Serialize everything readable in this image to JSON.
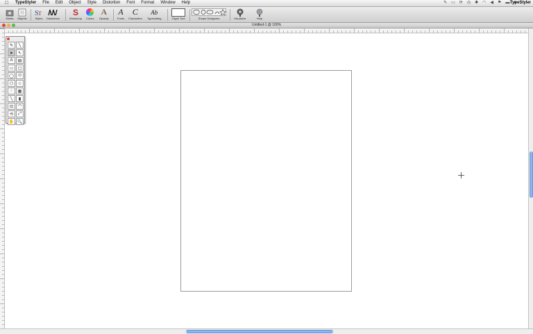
{
  "menubar": {
    "app": "TypeStyler",
    "menus": [
      "File",
      "Edit",
      "Object",
      "Style",
      "Distortion",
      "Font",
      "Format",
      "Window",
      "Help"
    ],
    "right_app": "TypeStyler"
  },
  "toolbar": {
    "items": [
      {
        "label": "Media",
        "icon": "media-icon"
      },
      {
        "label": "Objects",
        "icon": "objects-icon"
      },
      {
        "label": "Styles",
        "icon": "styles-icon"
      },
      {
        "label": "Distortions",
        "icon": "distortions-icon"
      },
      {
        "label": "Workshop",
        "icon": "workshop-icon",
        "glyph": "S"
      },
      {
        "label": "Colors",
        "icon": "colors-icon"
      },
      {
        "label": "Opacity",
        "icon": "opacity-icon",
        "glyph": "A"
      },
      {
        "label": "Fonts",
        "icon": "fonts-icon",
        "glyph": "A"
      },
      {
        "label": "Characters",
        "icon": "characters-icon",
        "glyph": "C"
      },
      {
        "label": "Typesetting",
        "icon": "typesetting-icon",
        "glyph": "Ab"
      },
      {
        "label": "Glyph Tool",
        "icon": "glyph-tool-icon"
      },
      {
        "label": "Shape Designers",
        "icon": "shape-designers-icon"
      },
      {
        "label": "Visualizer",
        "icon": "visualizer-icon"
      },
      {
        "label": "Help",
        "icon": "help-icon"
      }
    ],
    "colors": {
      "workshop": "#c0282d",
      "accent": "#3d6fc6"
    }
  },
  "window": {
    "title": "Untitled-1 @ 100%"
  },
  "palette": {
    "tools": [
      {
        "name": "tool-pen",
        "glyph": "✎"
      },
      {
        "name": "tool-line-pen",
        "glyph": "╲"
      },
      {
        "name": "tool-arrow",
        "glyph": "➤",
        "active": true
      },
      {
        "name": "tool-direct-select",
        "glyph": "↖"
      },
      {
        "name": "tool-text",
        "glyph": "A"
      },
      {
        "name": "tool-text-box",
        "glyph": "▤"
      },
      {
        "name": "tool-rectangle",
        "glyph": "▭"
      },
      {
        "name": "tool-rounded-rect",
        "glyph": "▢"
      },
      {
        "name": "tool-ellipse",
        "glyph": "◯"
      },
      {
        "name": "tool-oval",
        "glyph": "⬭"
      },
      {
        "name": "tool-polygon",
        "glyph": "⬡"
      },
      {
        "name": "tool-star",
        "glyph": "☆"
      },
      {
        "name": "tool-spiral",
        "glyph": "◌"
      },
      {
        "name": "tool-grid",
        "glyph": "▦"
      },
      {
        "name": "tool-line",
        "glyph": "╲"
      },
      {
        "name": "tool-fill",
        "glyph": "▮"
      },
      {
        "name": "tool-transform",
        "glyph": "⊡"
      },
      {
        "name": "tool-curve",
        "glyph": "⌒"
      },
      {
        "name": "tool-rotate",
        "glyph": "⟲"
      },
      {
        "name": "tool-scale",
        "glyph": "⤢"
      },
      {
        "name": "tool-hand",
        "glyph": "✋"
      },
      {
        "name": "tool-zoom",
        "glyph": "🔍"
      }
    ]
  }
}
